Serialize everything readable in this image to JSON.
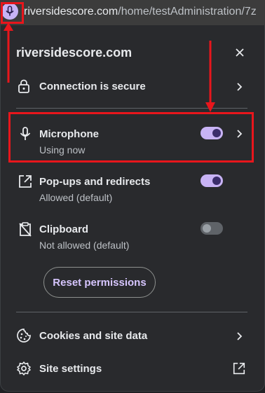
{
  "address_bar": {
    "domain": "riversidescore.com",
    "path": "/home/testAdministration/7z"
  },
  "panel": {
    "site_title": "riversidescore.com",
    "connection": {
      "label": "Connection is secure"
    },
    "permissions": [
      {
        "label": "Microphone",
        "status": "Using now",
        "enabled": true
      },
      {
        "label": "Pop-ups and redirects",
        "status": "Allowed (default)",
        "enabled": true
      },
      {
        "label": "Clipboard",
        "status": "Not allowed (default)",
        "enabled": false
      }
    ],
    "reset_label": "Reset permissions",
    "cookies_label": "Cookies and site data",
    "site_settings_label": "Site settings"
  },
  "colors": {
    "background": "#292a2d",
    "accent": "#c8b3f5",
    "annotation": "#e8161c"
  }
}
